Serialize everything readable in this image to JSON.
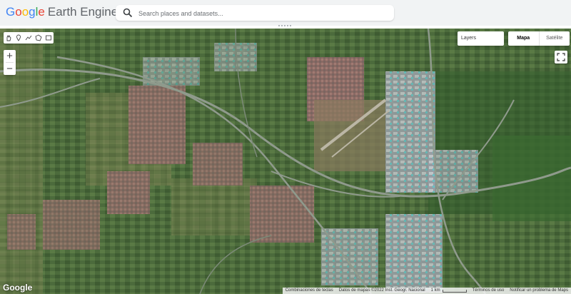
{
  "header": {
    "logo_google": "Google",
    "logo_product": "Earth Engine",
    "search_placeholder": "Search places and datasets..."
  },
  "map": {
    "layers_label": "Layers",
    "map_types": [
      "Mapa",
      "Satélite"
    ],
    "selected_map_type": "Mapa",
    "zoom_in_label": "+",
    "zoom_out_label": "−",
    "drawing_tools": [
      "hand-icon",
      "point-icon",
      "line-icon",
      "polygon-icon",
      "rectangle-icon"
    ],
    "watermark": "Google",
    "footer": {
      "shortcuts": "Combinaciones de teclas",
      "data": "Datos de mapas ©2022 Inst. Geogr. Nacional",
      "scale": "1 km",
      "terms": "Términos de uso",
      "report": "Notificar un problema de Maps"
    }
  },
  "colors": {
    "google_blue": "#4285F4",
    "google_red": "#EA4335",
    "google_yellow": "#FBBC05",
    "google_green": "#34A853",
    "header_bg": "#f1f3f4"
  }
}
